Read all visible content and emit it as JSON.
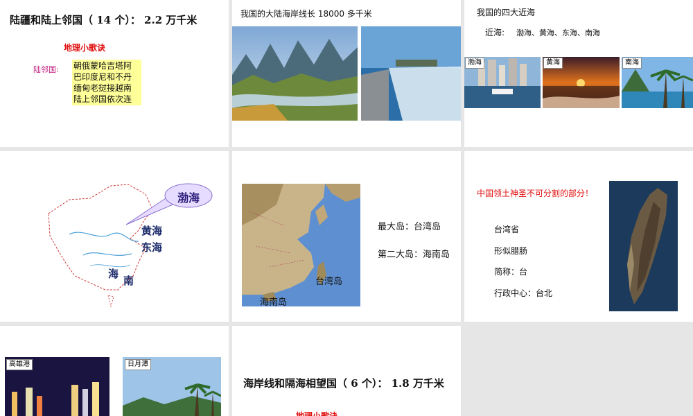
{
  "s1": {
    "title": "陆疆和陆上邻国（ 14 个）： 2.2 万千米",
    "rhyme_title": "地理小歌诀",
    "neighbors_label": "陆邻国:",
    "lines": [
      "朝俄蒙哈吉塔阿",
      "巴印度尼和不丹",
      "缅甸老挝接越南",
      "陆上邻国依次连"
    ]
  },
  "s2": {
    "title": "我国的大陆海岸线长 18000 多千米"
  },
  "s3": {
    "title": "我国的四大近海",
    "seas_label": "近海:",
    "seas": "渤海、黄海、东海、南海",
    "photo_labels": [
      "渤海",
      "黄海",
      "南海"
    ]
  },
  "s4": {
    "bohai": "渤海",
    "huanghai": "黄海",
    "donghai": "东海",
    "nan_hai_1": "海",
    "nan_hai_2": "南"
  },
  "s5": {
    "largest": "最大岛：台湾岛",
    "second": "第二大岛：海南岛",
    "map_taiwan": "台湾岛",
    "map_hainan": "海南岛"
  },
  "s6": {
    "headline": "中国领土神圣不可分割的部分！",
    "items": [
      "台湾省",
      "形似腊肠",
      "简称：台",
      "行政中心：台北"
    ]
  },
  "s7": {
    "label_left": "高雄港",
    "label_right": "日月潭"
  },
  "s8": {
    "title": "海岸线和隔海相望国（ 6 个）： 1.8 万千米",
    "rhyme_title": "地理小歌诀"
  },
  "colors": {
    "accent_red": "#e01010",
    "highlight": "#ffff99",
    "bubble": "#e6dcff"
  }
}
